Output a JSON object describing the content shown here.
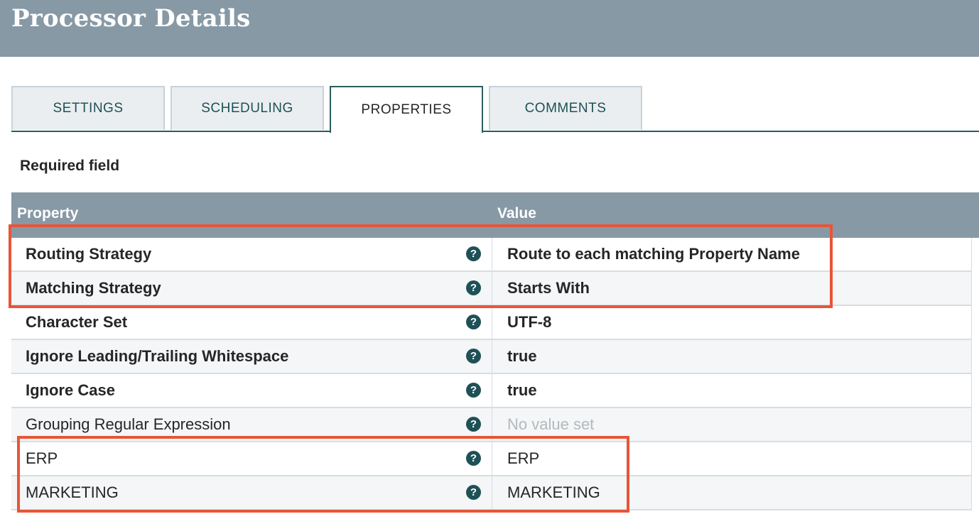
{
  "header": {
    "title": "Processor Details"
  },
  "tabs": [
    {
      "label": "SETTINGS",
      "active": false
    },
    {
      "label": "SCHEDULING",
      "active": false
    },
    {
      "label": "PROPERTIES",
      "active": true
    },
    {
      "label": "COMMENTS",
      "active": false
    }
  ],
  "required_label": "Required field",
  "table": {
    "columns": {
      "property": "Property",
      "value": "Value"
    },
    "rows": [
      {
        "name": "Routing Strategy",
        "value": "Route to each matching Property Name",
        "required": true
      },
      {
        "name": "Matching Strategy",
        "value": "Starts With",
        "required": true
      },
      {
        "name": "Character Set",
        "value": "UTF-8",
        "required": true
      },
      {
        "name": "Ignore Leading/Trailing Whitespace",
        "value": "true",
        "required": true
      },
      {
        "name": "Ignore Case",
        "value": "true",
        "required": true
      },
      {
        "name": "Grouping Regular Expression",
        "value": "No value set",
        "required": false,
        "empty": true
      },
      {
        "name": "ERP",
        "value": "ERP",
        "required": false
      },
      {
        "name": "MARKETING",
        "value": "MARKETING",
        "required": false
      }
    ],
    "help_glyph": "?"
  },
  "colors": {
    "header_bg": "#8799a5",
    "accent": "#1e5157",
    "highlight": "#e85537"
  }
}
